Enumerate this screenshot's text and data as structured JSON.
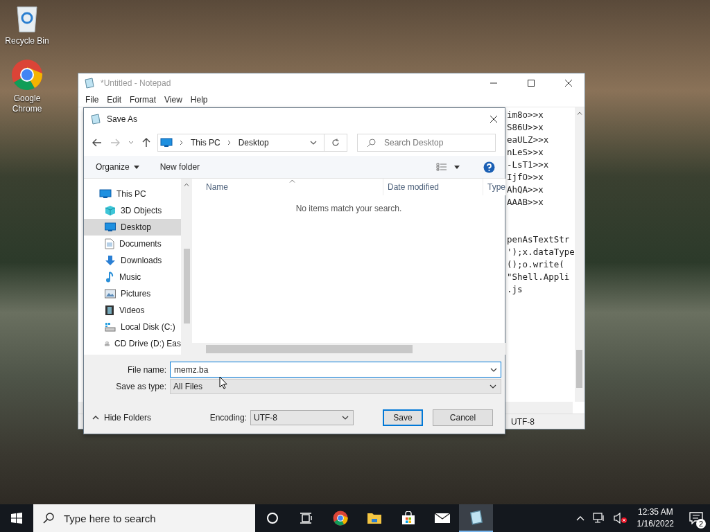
{
  "desktop": {
    "icons": [
      {
        "label": "Recycle Bin",
        "kind": "recycle"
      },
      {
        "label": "Google Chrome",
        "kind": "chrome"
      }
    ]
  },
  "notepad": {
    "title": "*Untitled - Notepad",
    "menu": [
      "File",
      "Edit",
      "Format",
      "View",
      "Help"
    ],
    "text_blocks": [
      [
        "im8o>>x",
        "S86U>>x",
        "eaULZ>>x",
        "nLeS>>x",
        "-LsT1>>x",
        "IjfO>>x",
        "AhQA>>x",
        "AAAB>>x"
      ],
      [
        "penAsTextStr",
        "');x.dataType",
        "();o.write(",
        "\"Shell.Appli",
        ".js"
      ]
    ],
    "status": "UTF-8"
  },
  "save_dialog": {
    "title": "Save As",
    "breadcrumb": [
      "This PC",
      "Desktop"
    ],
    "search": {
      "placeholder": "Search Desktop"
    },
    "organize": "Organize",
    "new_folder": "New folder",
    "nav_items": [
      {
        "label": "This PC",
        "kind": "pc",
        "selected": false,
        "children": [
          {
            "label": "3D Objects",
            "kind": "objects",
            "selected": false
          },
          {
            "label": "Desktop",
            "kind": "desktop",
            "selected": true
          },
          {
            "label": "Documents",
            "kind": "documents",
            "selected": false
          },
          {
            "label": "Downloads",
            "kind": "downloads",
            "selected": false
          },
          {
            "label": "Music",
            "kind": "music",
            "selected": false
          },
          {
            "label": "Pictures",
            "kind": "pictures",
            "selected": false
          },
          {
            "label": "Videos",
            "kind": "videos",
            "selected": false
          },
          {
            "label": "Local Disk (C:)",
            "kind": "disk",
            "selected": false
          },
          {
            "label": "CD Drive (D:) Eas",
            "kind": "cd",
            "selected": false
          }
        ]
      }
    ],
    "columns": [
      "Name",
      "Date modified",
      "Type"
    ],
    "empty_message": "No items match your search.",
    "file_name": {
      "label": "File name:",
      "value": "memz.ba"
    },
    "save_as_type": {
      "label": "Save as type:",
      "value": "All Files"
    },
    "hide_folders": "Hide Folders",
    "encoding": {
      "label": "Encoding:",
      "value": "UTF-8"
    },
    "buttons": [
      {
        "label": "Save",
        "kind": "default"
      },
      {
        "label": "Cancel",
        "kind": "normal"
      }
    ]
  },
  "taskbar": {
    "search": {
      "placeholder": "Type here to search"
    },
    "apps": [
      {
        "kind": "cortana",
        "active": false
      },
      {
        "kind": "taskview",
        "active": false
      },
      {
        "kind": "chrome",
        "active": false
      },
      {
        "kind": "explorer",
        "active": false
      },
      {
        "kind": "store",
        "active": false
      },
      {
        "kind": "mail",
        "active": false
      },
      {
        "kind": "notepad",
        "active": true
      }
    ],
    "time": "12:35 AM",
    "date": "1/16/2022",
    "notifications": "2"
  }
}
